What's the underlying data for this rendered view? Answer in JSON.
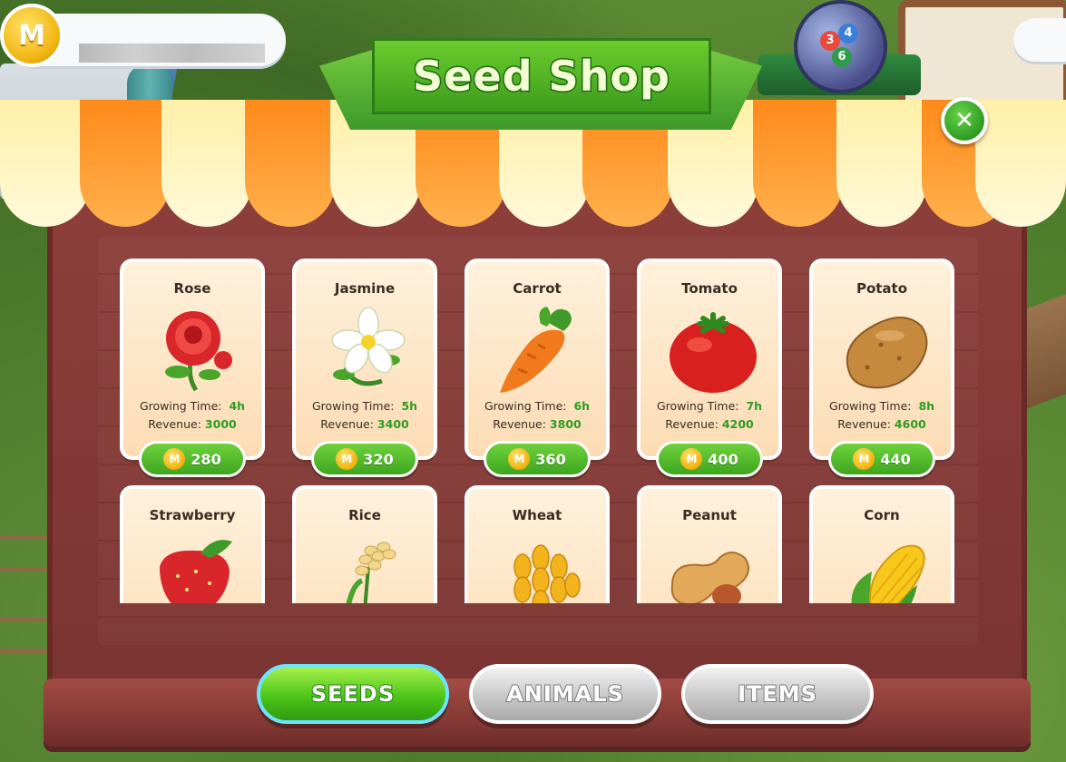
{
  "hud": {
    "coin_symbol": "M",
    "player_name_redacted": ""
  },
  "shop": {
    "title": "Seed Shop",
    "close_symbol": "✕"
  },
  "labels": {
    "growing_time": "Growing Time:",
    "revenue": "Revenue:"
  },
  "seeds": [
    {
      "name": "Rose",
      "growing_time": "4h",
      "revenue": "3000",
      "price": "280",
      "icon": "rose-icon"
    },
    {
      "name": "Jasmine",
      "growing_time": "5h",
      "revenue": "3400",
      "price": "320",
      "icon": "jasmine-icon"
    },
    {
      "name": "Carrot",
      "growing_time": "6h",
      "revenue": "3800",
      "price": "360",
      "icon": "carrot-icon"
    },
    {
      "name": "Tomato",
      "growing_time": "7h",
      "revenue": "4200",
      "price": "400",
      "icon": "tomato-icon"
    },
    {
      "name": "Potato",
      "growing_time": "8h",
      "revenue": "4600",
      "price": "440",
      "icon": "potato-icon"
    },
    {
      "name": "Strawberry",
      "icon": "strawberry-icon"
    },
    {
      "name": "Rice",
      "icon": "rice-icon"
    },
    {
      "name": "Wheat",
      "icon": "wheat-icon"
    },
    {
      "name": "Peanut",
      "icon": "peanut-icon"
    },
    {
      "name": "Corn",
      "icon": "corn-icon"
    }
  ],
  "tabs": [
    {
      "label": "SEEDS",
      "active": true
    },
    {
      "label": "ANIMALS",
      "active": false
    },
    {
      "label": "ITEMS",
      "active": false
    }
  ],
  "lottery_balls": [
    "3",
    "4",
    "6"
  ],
  "colors": {
    "accent_green": "#3ea51f",
    "coin_gold": "#f1b511",
    "shop_wood": "#8c3f3a"
  }
}
